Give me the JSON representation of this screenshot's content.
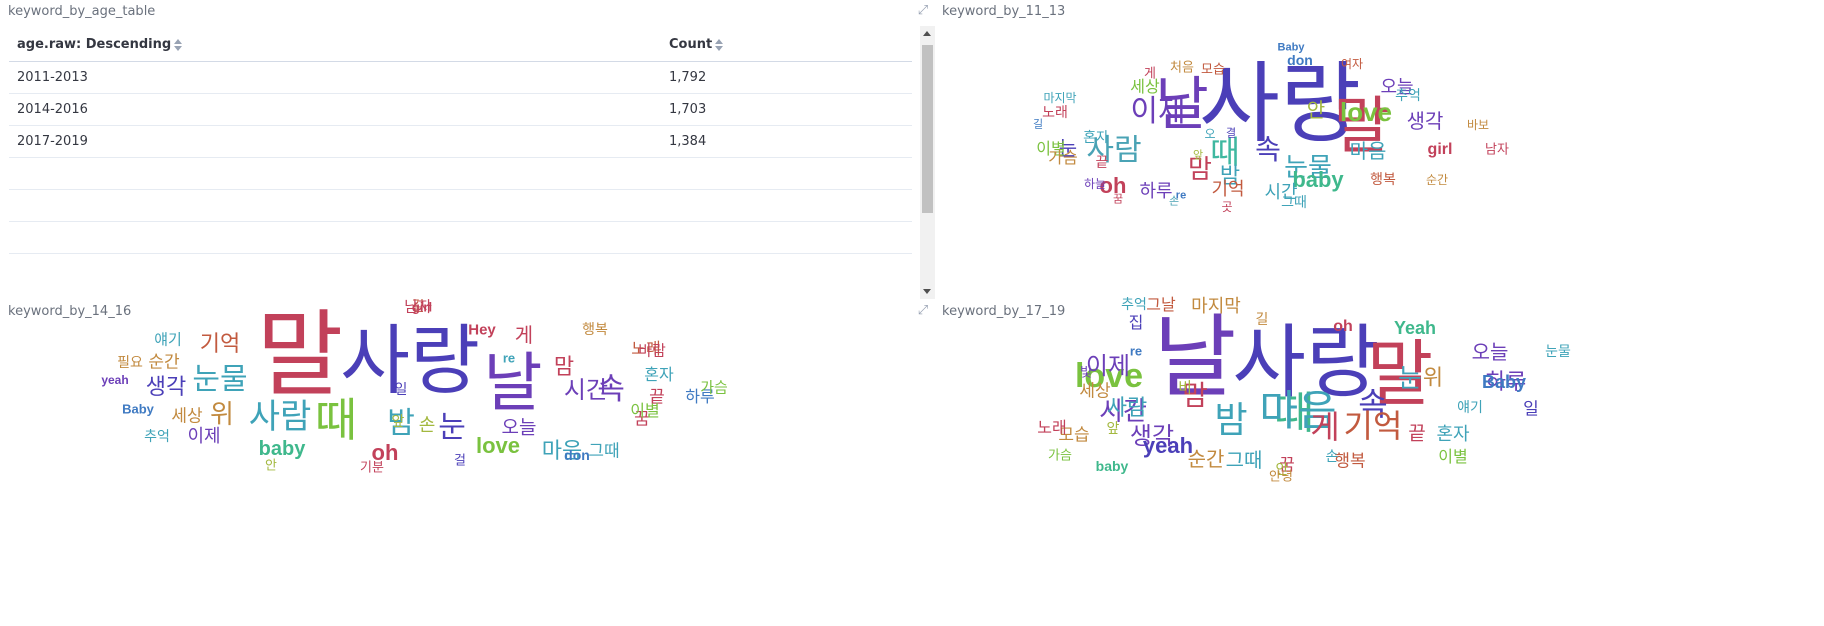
{
  "table_panel": {
    "title": "keyword_by_age_table",
    "columns": [
      "age.raw: Descending",
      "Count"
    ],
    "rows": [
      [
        "2011-2013",
        "1,792"
      ],
      [
        "2014-2016",
        "1,703"
      ],
      [
        "2017-2019",
        "1,384"
      ]
    ]
  },
  "cloud_11_13": {
    "title": "keyword_by_11_13",
    "words": [
      {
        "t": "사랑",
        "c": "#4b3fb8"
      },
      {
        "t": "날",
        "c": "#6c3fb8"
      },
      {
        "t": "말",
        "c": "#c2415a"
      },
      {
        "t": "때",
        "c": "#3fb8a0"
      },
      {
        "t": "사람",
        "c": "#4aa3b5"
      },
      {
        "t": "이제",
        "c": "#6c3fb8"
      },
      {
        "t": "속",
        "c": "#4b3fb8"
      },
      {
        "t": "눈물",
        "c": "#3fa3b8"
      },
      {
        "t": "맘",
        "c": "#c2415a"
      },
      {
        "t": "love",
        "c": "#7ac23f"
      },
      {
        "t": "baby",
        "c": "#3fb88c"
      },
      {
        "t": "oh",
        "c": "#c2415a"
      },
      {
        "t": "밤",
        "c": "#3fa3b8"
      },
      {
        "t": "안",
        "c": "#a3b83f"
      },
      {
        "t": "눈",
        "c": "#4b3fb8"
      },
      {
        "t": "마음",
        "c": "#3fa3b8"
      },
      {
        "t": "생각",
        "c": "#6c3fb8"
      },
      {
        "t": "오늘",
        "c": "#6c3fb8"
      },
      {
        "t": "세상",
        "c": "#7ac23f"
      },
      {
        "t": "기억",
        "c": "#c25a3f"
      },
      {
        "t": "시간",
        "c": "#3fa3b8"
      },
      {
        "t": "하루",
        "c": "#6c3fb8"
      },
      {
        "t": "이별",
        "c": "#7ac23f"
      },
      {
        "t": "가슴",
        "c": "#c28a3f"
      },
      {
        "t": "혼자",
        "c": "#3fa3b8"
      },
      {
        "t": "노래",
        "c": "#c2415a"
      },
      {
        "t": "처음",
        "c": "#c28a3f"
      },
      {
        "t": "모습",
        "c": "#c25a3f"
      },
      {
        "t": "Baby",
        "c": "#3f7ac2"
      },
      {
        "t": "don",
        "c": "#3f7ac2"
      },
      {
        "t": "여자",
        "c": "#c25a3f"
      },
      {
        "t": "추억",
        "c": "#3fa3b8"
      },
      {
        "t": "바보",
        "c": "#c28a3f"
      },
      {
        "t": "girl",
        "c": "#c2415a"
      },
      {
        "t": "남자",
        "c": "#c2415a"
      },
      {
        "t": "행복",
        "c": "#c25a3f"
      },
      {
        "t": "순간",
        "c": "#c28a3f"
      },
      {
        "t": "그때",
        "c": "#3fa3b8"
      },
      {
        "t": "마지막",
        "c": "#3fa3b8"
      },
      {
        "t": "길",
        "c": "#3f7ac2"
      },
      {
        "t": "끝",
        "c": "#c2415a"
      },
      {
        "t": "하늘",
        "c": "#6c3fb8"
      },
      {
        "t": "꿈",
        "c": "#c2415a"
      },
      {
        "t": "손",
        "c": "#4aa3b5"
      },
      {
        "t": "re",
        "c": "#3f7ac2"
      },
      {
        "t": "오",
        "c": "#3fa3b8"
      },
      {
        "t": "곳",
        "c": "#c2415a"
      },
      {
        "t": "게",
        "c": "#c2415a"
      },
      {
        "t": "앞",
        "c": "#a3b83f"
      },
      {
        "t": "결",
        "c": "#4b3fb8"
      }
    ]
  },
  "cloud_14_16": {
    "title": "keyword_by_14_16",
    "words": [
      {
        "t": "말",
        "c": "#c2415a"
      },
      {
        "t": "사랑",
        "c": "#4b3fb8"
      },
      {
        "t": "날",
        "c": "#6c3fb8"
      },
      {
        "t": "때",
        "c": "#7ac23f"
      },
      {
        "t": "사람",
        "c": "#3fa3b8"
      },
      {
        "t": "눈물",
        "c": "#3fa3b8"
      },
      {
        "t": "밤",
        "c": "#3fa3b8"
      },
      {
        "t": "눈",
        "c": "#4b3fb8"
      },
      {
        "t": "속",
        "c": "#6c3fb8"
      },
      {
        "t": "위",
        "c": "#c28a3f"
      },
      {
        "t": "기억",
        "c": "#c25a3f"
      },
      {
        "t": "생각",
        "c": "#4b3fb8"
      },
      {
        "t": "맘",
        "c": "#c2415a"
      },
      {
        "t": "게",
        "c": "#c2415a"
      },
      {
        "t": "시간",
        "c": "#6c3fb8"
      },
      {
        "t": "마음",
        "c": "#3fa3b8"
      },
      {
        "t": "love",
        "c": "#7ac23f"
      },
      {
        "t": "baby",
        "c": "#3fb88c"
      },
      {
        "t": "oh",
        "c": "#c2415a"
      },
      {
        "t": "오늘",
        "c": "#6c3fb8"
      },
      {
        "t": "순간",
        "c": "#c28a3f"
      },
      {
        "t": "세상",
        "c": "#c28a3f"
      },
      {
        "t": "이제",
        "c": "#6c3fb8"
      },
      {
        "t": "손",
        "c": "#a3b83f"
      },
      {
        "t": "그때",
        "c": "#3fa3b8"
      },
      {
        "t": "꿈",
        "c": "#c2415a"
      },
      {
        "t": "끝",
        "c": "#c2415a"
      },
      {
        "t": "하루",
        "c": "#3f7ac2"
      },
      {
        "t": "가슴",
        "c": "#7ac23f"
      },
      {
        "t": "혼자",
        "c": "#3fa3b8"
      },
      {
        "t": "이별",
        "c": "#7ac23f"
      },
      {
        "t": "노래",
        "c": "#c25a3f"
      },
      {
        "t": "행복",
        "c": "#c28a3f"
      },
      {
        "t": "바람",
        "c": "#c2415a"
      },
      {
        "t": "Hey",
        "c": "#c2415a"
      },
      {
        "t": "길",
        "c": "#c25a3f"
      },
      {
        "t": "re",
        "c": "#3fa3b8"
      },
      {
        "t": "girl",
        "c": "#c2415a"
      },
      {
        "t": "남자",
        "c": "#c2415a"
      },
      {
        "t": "얘기",
        "c": "#3fa3b8"
      },
      {
        "t": "필요",
        "c": "#c28a3f"
      },
      {
        "t": "yeah",
        "c": "#6c3fb8"
      },
      {
        "t": "Baby",
        "c": "#3f7ac2"
      },
      {
        "t": "추억",
        "c": "#3fa3b8"
      },
      {
        "t": "안",
        "c": "#a3b83f"
      },
      {
        "t": "기분",
        "c": "#c2415a"
      },
      {
        "t": "일",
        "c": "#4b3fb8"
      },
      {
        "t": "앞",
        "c": "#a3b83f"
      },
      {
        "t": "걸",
        "c": "#4b3fb8"
      },
      {
        "t": "don",
        "c": "#3f7ac2"
      }
    ]
  },
  "cloud_17_19": {
    "title": "keyword_by_17_19",
    "words": [
      {
        "t": "날",
        "c": "#6c3fb8"
      },
      {
        "t": "사랑",
        "c": "#4b3fb8"
      },
      {
        "t": "말",
        "c": "#c2415a"
      },
      {
        "t": "때",
        "c": "#3fb88c"
      },
      {
        "t": "마음",
        "c": "#3fa3b8"
      },
      {
        "t": "밤",
        "c": "#3fa3b8"
      },
      {
        "t": "love",
        "c": "#7ac23f"
      },
      {
        "t": "속",
        "c": "#4b3fb8"
      },
      {
        "t": "게",
        "c": "#c2415a"
      },
      {
        "t": "기억",
        "c": "#c25a3f"
      },
      {
        "t": "맘",
        "c": "#c2415a"
      },
      {
        "t": "시간",
        "c": "#6c3fb8"
      },
      {
        "t": "사람",
        "c": "#3fa3b8"
      },
      {
        "t": "눈",
        "c": "#3fa3b8"
      },
      {
        "t": "이제",
        "c": "#6c3fb8"
      },
      {
        "t": "하루",
        "c": "#6c3fb8"
      },
      {
        "t": "생각",
        "c": "#6c3fb8"
      },
      {
        "t": "yeah",
        "c": "#4b3fb8"
      },
      {
        "t": "위",
        "c": "#c28a3f"
      },
      {
        "t": "Baby",
        "c": "#3f7ac2"
      },
      {
        "t": "Yeah",
        "c": "#3fb88c"
      },
      {
        "t": "오늘",
        "c": "#6c3fb8"
      },
      {
        "t": "oh",
        "c": "#c2415a"
      },
      {
        "t": "그때",
        "c": "#3fa3b8"
      },
      {
        "t": "순간",
        "c": "#c28a3f"
      },
      {
        "t": "꿈",
        "c": "#c2415a"
      },
      {
        "t": "행복",
        "c": "#c25a3f"
      },
      {
        "t": "끝",
        "c": "#c2415a"
      },
      {
        "t": "혼자",
        "c": "#3fa3b8"
      },
      {
        "t": "이별",
        "c": "#7ac23f"
      },
      {
        "t": "세상",
        "c": "#c28a3f"
      },
      {
        "t": "모습",
        "c": "#c28a3f"
      },
      {
        "t": "노래",
        "c": "#c2415a"
      },
      {
        "t": "마지막",
        "c": "#c28a3f"
      },
      {
        "t": "그날",
        "c": "#c25a3f"
      },
      {
        "t": "추억",
        "c": "#3fa3b8"
      },
      {
        "t": "baby",
        "c": "#3fb88c"
      },
      {
        "t": "가슴",
        "c": "#7ac23f"
      },
      {
        "t": "손",
        "c": "#3fa3b8"
      },
      {
        "t": "얘기",
        "c": "#3fa3b8"
      },
      {
        "t": "눈물",
        "c": "#3fa3b8"
      },
      {
        "t": "일",
        "c": "#4b3fb8"
      },
      {
        "t": "빛",
        "c": "#6c3fb8"
      },
      {
        "t": "앞",
        "c": "#a3b83f"
      },
      {
        "t": "비",
        "c": "#a3b83f"
      },
      {
        "t": "집",
        "c": "#4b3fb8"
      },
      {
        "t": "re",
        "c": "#3f7ac2"
      },
      {
        "t": "길",
        "c": "#c28a3f"
      },
      {
        "t": "안",
        "c": "#a3b83f"
      },
      {
        "t": "안녕",
        "c": "#c28a3f"
      }
    ]
  }
}
